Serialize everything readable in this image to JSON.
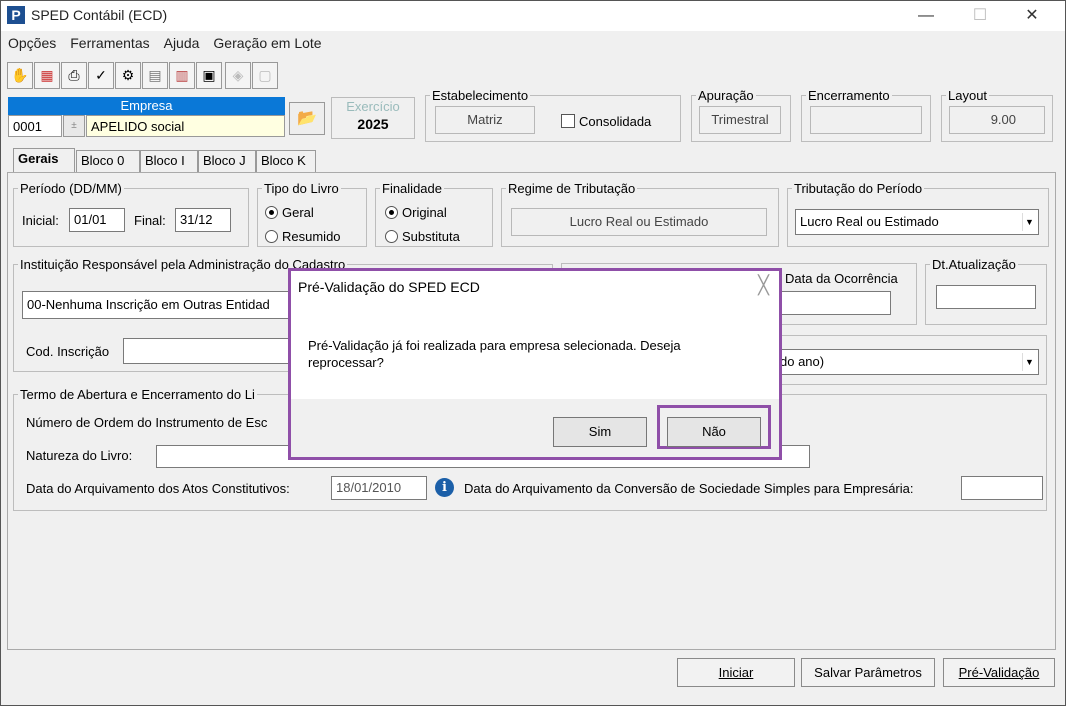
{
  "window": {
    "title": "SPED Contábil (ECD)",
    "app_icon": "P",
    "minimize": "—",
    "maximize": "☐",
    "close": "✕"
  },
  "menu": [
    "Opções",
    "Ferramentas",
    "Ajuda",
    "Geração em Lote"
  ],
  "empresa": {
    "header": "Empresa",
    "code": "0001",
    "name": "APELIDO social"
  },
  "exercicio": {
    "label": "Exercício",
    "value": "2025"
  },
  "estabelecimento": {
    "legend": "Estabelecimento",
    "value": "Matriz",
    "consolidada": "Consolidada"
  },
  "apuracao": {
    "legend": "Apuração",
    "value": "Trimestral"
  },
  "encerramento": {
    "legend": "Encerramento",
    "value": ""
  },
  "layout": {
    "legend": "Layout",
    "value": "9.00"
  },
  "tabs": [
    "Gerais",
    "Bloco 0",
    "Bloco I",
    "Bloco J",
    "Bloco K"
  ],
  "periodo": {
    "legend": "Período (DD/MM)",
    "inicial_label": "Inicial:",
    "inicial": "01/01",
    "final_label": "Final:",
    "final": "31/12"
  },
  "tipo_livro": {
    "legend": "Tipo do Livro",
    "opt1": "Geral",
    "opt2": "Resumido"
  },
  "finalidade": {
    "legend": "Finalidade",
    "opt1": "Original",
    "opt2": "Substituta"
  },
  "regime": {
    "legend": "Regime de Tributação",
    "value": "Lucro Real ou Estimado"
  },
  "trib_periodo": {
    "legend": "Tributação do Período",
    "value": "Lucro Real ou Estimado"
  },
  "instituicao": {
    "legend": "Instituição Responsável pela Administração do Cadastro",
    "value": "00-Nenhuma Inscrição em Outras Entidad",
    "cod_label": "Cod. Inscrição"
  },
  "ocorrencia": {
    "legend": "Data da Ocorrência"
  },
  "dt_atualizacao": {
    "legend": "Dt.Atualização"
  },
  "periodo_sel": {
    "value": "do ano)"
  },
  "termo": {
    "legend": "Termo de Abertura e Encerramento do Li",
    "numero_label": "Número de Ordem do Instrumento de Esc",
    "natureza_label": "Natureza do Livro:",
    "arquivamento_label": "Data do Arquivamento dos Atos Constitutivos:",
    "arquivamento": "18/01/2010",
    "conversao_label": "Data do Arquivamento da Conversão de Sociedade Simples para Empresária:"
  },
  "buttons": {
    "iniciar": "Iniciar",
    "salvar": "Salvar Parâmetros",
    "pre_validacao": "Pré-Validação"
  },
  "dialog": {
    "title": "Pré-Validação do SPED ECD",
    "close": "╳",
    "message": "Pré-Validação já foi realizada para empresa selecionada. Deseja reprocessar?",
    "yes": "Sim",
    "no": "Não"
  },
  "colors": {
    "highlight": "#8f4fa8",
    "empresa_header": "#0a78d7",
    "empresa_field": "#ffffe1"
  }
}
